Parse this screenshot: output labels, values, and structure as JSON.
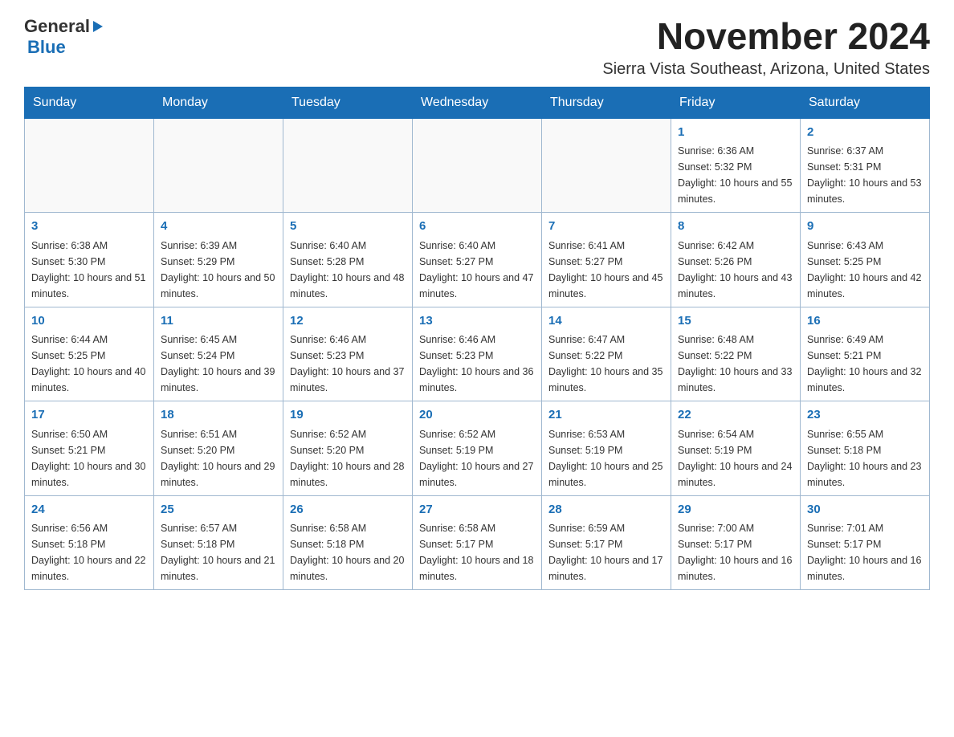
{
  "logo": {
    "general": "General",
    "blue": "Blue"
  },
  "title": {
    "month": "November 2024",
    "location": "Sierra Vista Southeast, Arizona, United States"
  },
  "days_of_week": [
    "Sunday",
    "Monday",
    "Tuesday",
    "Wednesday",
    "Thursday",
    "Friday",
    "Saturday"
  ],
  "weeks": [
    [
      {
        "day": "",
        "info": ""
      },
      {
        "day": "",
        "info": ""
      },
      {
        "day": "",
        "info": ""
      },
      {
        "day": "",
        "info": ""
      },
      {
        "day": "",
        "info": ""
      },
      {
        "day": "1",
        "info": "Sunrise: 6:36 AM\nSunset: 5:32 PM\nDaylight: 10 hours and 55 minutes."
      },
      {
        "day": "2",
        "info": "Sunrise: 6:37 AM\nSunset: 5:31 PM\nDaylight: 10 hours and 53 minutes."
      }
    ],
    [
      {
        "day": "3",
        "info": "Sunrise: 6:38 AM\nSunset: 5:30 PM\nDaylight: 10 hours and 51 minutes."
      },
      {
        "day": "4",
        "info": "Sunrise: 6:39 AM\nSunset: 5:29 PM\nDaylight: 10 hours and 50 minutes."
      },
      {
        "day": "5",
        "info": "Sunrise: 6:40 AM\nSunset: 5:28 PM\nDaylight: 10 hours and 48 minutes."
      },
      {
        "day": "6",
        "info": "Sunrise: 6:40 AM\nSunset: 5:27 PM\nDaylight: 10 hours and 47 minutes."
      },
      {
        "day": "7",
        "info": "Sunrise: 6:41 AM\nSunset: 5:27 PM\nDaylight: 10 hours and 45 minutes."
      },
      {
        "day": "8",
        "info": "Sunrise: 6:42 AM\nSunset: 5:26 PM\nDaylight: 10 hours and 43 minutes."
      },
      {
        "day": "9",
        "info": "Sunrise: 6:43 AM\nSunset: 5:25 PM\nDaylight: 10 hours and 42 minutes."
      }
    ],
    [
      {
        "day": "10",
        "info": "Sunrise: 6:44 AM\nSunset: 5:25 PM\nDaylight: 10 hours and 40 minutes."
      },
      {
        "day": "11",
        "info": "Sunrise: 6:45 AM\nSunset: 5:24 PM\nDaylight: 10 hours and 39 minutes."
      },
      {
        "day": "12",
        "info": "Sunrise: 6:46 AM\nSunset: 5:23 PM\nDaylight: 10 hours and 37 minutes."
      },
      {
        "day": "13",
        "info": "Sunrise: 6:46 AM\nSunset: 5:23 PM\nDaylight: 10 hours and 36 minutes."
      },
      {
        "day": "14",
        "info": "Sunrise: 6:47 AM\nSunset: 5:22 PM\nDaylight: 10 hours and 35 minutes."
      },
      {
        "day": "15",
        "info": "Sunrise: 6:48 AM\nSunset: 5:22 PM\nDaylight: 10 hours and 33 minutes."
      },
      {
        "day": "16",
        "info": "Sunrise: 6:49 AM\nSunset: 5:21 PM\nDaylight: 10 hours and 32 minutes."
      }
    ],
    [
      {
        "day": "17",
        "info": "Sunrise: 6:50 AM\nSunset: 5:21 PM\nDaylight: 10 hours and 30 minutes."
      },
      {
        "day": "18",
        "info": "Sunrise: 6:51 AM\nSunset: 5:20 PM\nDaylight: 10 hours and 29 minutes."
      },
      {
        "day": "19",
        "info": "Sunrise: 6:52 AM\nSunset: 5:20 PM\nDaylight: 10 hours and 28 minutes."
      },
      {
        "day": "20",
        "info": "Sunrise: 6:52 AM\nSunset: 5:19 PM\nDaylight: 10 hours and 27 minutes."
      },
      {
        "day": "21",
        "info": "Sunrise: 6:53 AM\nSunset: 5:19 PM\nDaylight: 10 hours and 25 minutes."
      },
      {
        "day": "22",
        "info": "Sunrise: 6:54 AM\nSunset: 5:19 PM\nDaylight: 10 hours and 24 minutes."
      },
      {
        "day": "23",
        "info": "Sunrise: 6:55 AM\nSunset: 5:18 PM\nDaylight: 10 hours and 23 minutes."
      }
    ],
    [
      {
        "day": "24",
        "info": "Sunrise: 6:56 AM\nSunset: 5:18 PM\nDaylight: 10 hours and 22 minutes."
      },
      {
        "day": "25",
        "info": "Sunrise: 6:57 AM\nSunset: 5:18 PM\nDaylight: 10 hours and 21 minutes."
      },
      {
        "day": "26",
        "info": "Sunrise: 6:58 AM\nSunset: 5:18 PM\nDaylight: 10 hours and 20 minutes."
      },
      {
        "day": "27",
        "info": "Sunrise: 6:58 AM\nSunset: 5:17 PM\nDaylight: 10 hours and 18 minutes."
      },
      {
        "day": "28",
        "info": "Sunrise: 6:59 AM\nSunset: 5:17 PM\nDaylight: 10 hours and 17 minutes."
      },
      {
        "day": "29",
        "info": "Sunrise: 7:00 AM\nSunset: 5:17 PM\nDaylight: 10 hours and 16 minutes."
      },
      {
        "day": "30",
        "info": "Sunrise: 7:01 AM\nSunset: 5:17 PM\nDaylight: 10 hours and 16 minutes."
      }
    ]
  ]
}
